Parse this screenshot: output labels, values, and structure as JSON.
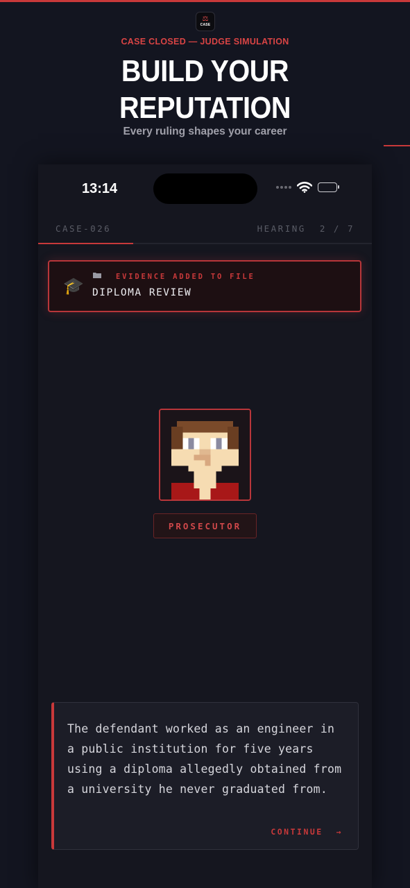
{
  "promo": {
    "app_icon_text": "CASE",
    "subtitle": "CASE CLOSED — JUDGE SIMULATION",
    "headline_line1": "BUILD YOUR",
    "headline_line2": "REPUTATION",
    "tagline": "Every ruling shapes your career"
  },
  "status_bar": {
    "time": "13:14"
  },
  "game": {
    "case_id": "CASE-026",
    "hearing_label": "HEARING",
    "hearing_progress": "2 / 7",
    "hearing_current": 2,
    "hearing_total": 7,
    "evidence": {
      "label": "EVIDENCE ADDED TO FILE",
      "title": "DIPLOMA REVIEW",
      "icon": "graduation-cap-icon"
    },
    "speaker": {
      "role": "PROSECUTOR"
    },
    "dialogue": {
      "text": "The defendant worked as an engineer in a public institution for five years using a diploma allegedly obtained from a university he never graduated from.",
      "continue_label": "CONTINUE  →"
    }
  },
  "colors": {
    "accent": "#c8393a",
    "background": "#131520",
    "panel": "#1c1d27"
  }
}
